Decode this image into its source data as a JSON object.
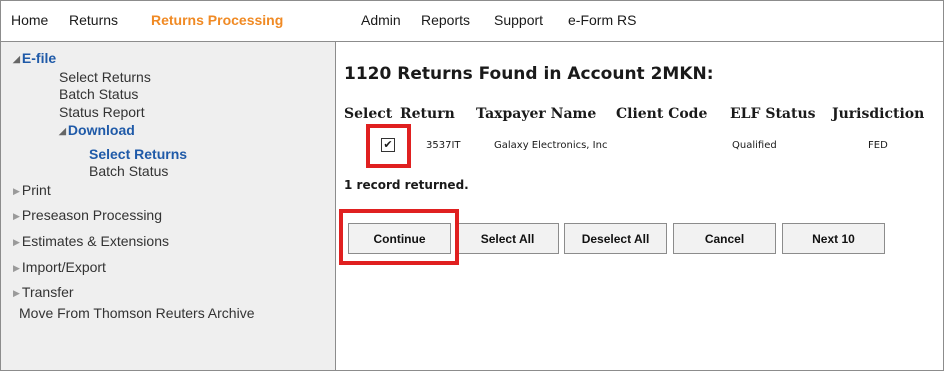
{
  "nav": {
    "items": [
      "Home",
      "Returns",
      "Returns Processing",
      "Admin",
      "Reports",
      "Support",
      "e-Form RS"
    ],
    "active": "Returns Processing"
  },
  "sidebar": {
    "efile": "E-file",
    "select_returns": "Select Returns",
    "batch_status": "Batch Status",
    "status_report": "Status Report",
    "download": "Download",
    "download_select_returns": "Select Returns",
    "download_batch_status": "Batch Status",
    "print": "Print",
    "preseason": "Preseason Processing",
    "estimates": "Estimates & Extensions",
    "import_export": "Import/Export",
    "transfer": "Transfer",
    "move_archive": "Move From Thomson Reuters Archive"
  },
  "main": {
    "title": "1120 Returns Found in Account 2MKN:",
    "columns": [
      "Select",
      "Return",
      "Taxpayer Name",
      "Client Code",
      "ELF Status",
      "Jurisdiction"
    ],
    "rows": [
      {
        "selected": true,
        "return": "3537IT",
        "taxpayer": "Galaxy Electronics, Inc",
        "client_code": "",
        "elf_status": "Qualified",
        "jurisdiction": "FED"
      }
    ],
    "records_text": "1 record returned.",
    "buttons": {
      "continue": "Continue",
      "select_all": "Select All",
      "deselect_all": "Deselect All",
      "cancel": "Cancel",
      "next10": "Next 10"
    }
  },
  "colors": {
    "active_nav": "#f08a24",
    "link_blue": "#1f5aa8",
    "highlight": "#e02020"
  }
}
